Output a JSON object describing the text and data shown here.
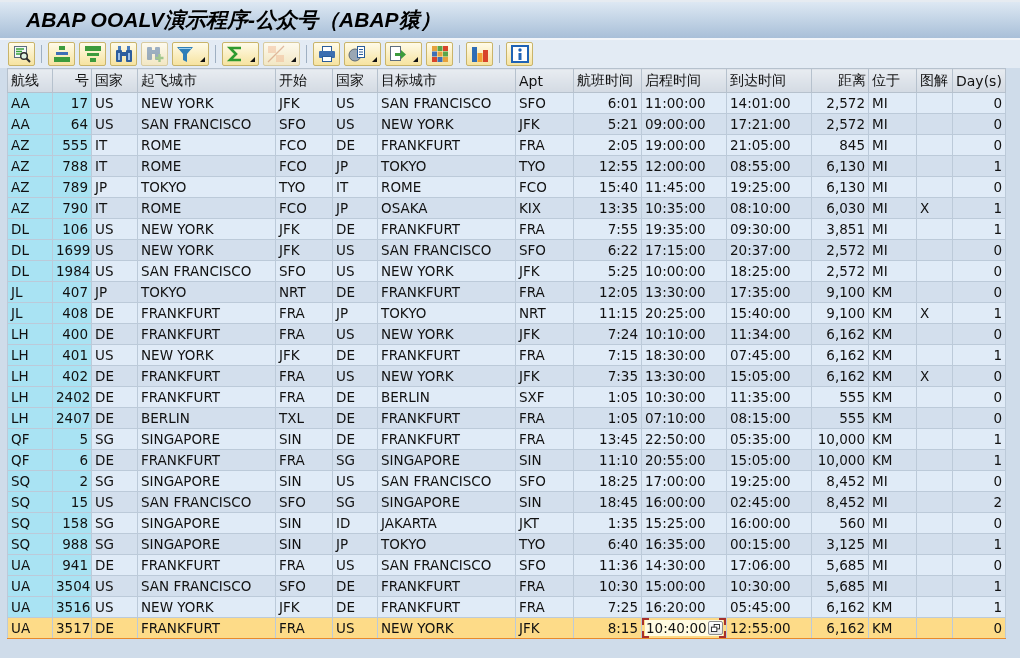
{
  "window": {
    "title": "ABAP OOALV演示程序-公众号（ABAP猿）"
  },
  "toolbar": [
    {
      "buttons": [
        {
          "kind": "details",
          "disabled": false,
          "dropdown": false
        }
      ]
    },
    {
      "buttons": [
        {
          "kind": "ascending",
          "disabled": false,
          "dropdown": false
        },
        {
          "kind": "descending",
          "disabled": false,
          "dropdown": false
        },
        {
          "kind": "find",
          "disabled": false,
          "dropdown": false
        },
        {
          "kind": "findnext",
          "disabled": true,
          "dropdown": false
        },
        {
          "kind": "filter",
          "disabled": false,
          "dropdown": true
        }
      ]
    },
    {
      "buttons": [
        {
          "kind": "sum",
          "disabled": false,
          "dropdown": true
        },
        {
          "kind": "subtotal",
          "disabled": true,
          "dropdown": true
        }
      ]
    },
    {
      "buttons": [
        {
          "kind": "print",
          "disabled": false,
          "dropdown": false
        },
        {
          "kind": "views",
          "disabled": false,
          "dropdown": true
        },
        {
          "kind": "export",
          "disabled": false,
          "dropdown": true
        },
        {
          "kind": "layout",
          "disabled": false,
          "dropdown": false
        }
      ]
    },
    {
      "buttons": [
        {
          "kind": "graphic",
          "disabled": false,
          "dropdown": false
        }
      ]
    },
    {
      "buttons": [
        {
          "kind": "info",
          "disabled": false,
          "dropdown": false
        }
      ]
    }
  ],
  "table": {
    "columns": [
      {
        "label": "航线",
        "key": true
      },
      {
        "label": "号",
        "key": true
      },
      {
        "label": "国家",
        "key": false
      },
      {
        "label": "起飞城市",
        "key": false
      },
      {
        "label": "开始",
        "key": false
      },
      {
        "label": "国家",
        "key": false
      },
      {
        "label": "目标城市",
        "key": false
      },
      {
        "label": "Apt",
        "key": false
      },
      {
        "label": "航班时间",
        "key": false
      },
      {
        "label": "启程时间",
        "key": false
      },
      {
        "label": "到达时间",
        "key": false
      },
      {
        "label": "距离",
        "key": false
      },
      {
        "label": "位于",
        "key": false
      },
      {
        "label": "图解",
        "key": false
      },
      {
        "label": "Day(s)",
        "key": false
      }
    ],
    "rows": [
      {
        "selected": false,
        "cells": [
          "AA",
          "17",
          "US",
          "NEW YORK",
          "JFK",
          "US",
          "SAN FRANCISCO",
          "SFO",
          "6:01",
          "11:00:00",
          "14:01:00",
          "2,572",
          "MI",
          null,
          "0"
        ]
      },
      {
        "selected": false,
        "cells": [
          "AA",
          "64",
          "US",
          "SAN FRANCISCO",
          "SFO",
          "US",
          "NEW YORK",
          "JFK",
          "5:21",
          "09:00:00",
          "17:21:00",
          "2,572",
          "MI",
          null,
          "0"
        ]
      },
      {
        "selected": false,
        "cells": [
          "AZ",
          "555",
          "IT",
          "ROME",
          "FCO",
          "DE",
          "FRANKFURT",
          "FRA",
          "2:05",
          "19:00:00",
          "21:05:00",
          "845",
          "MI",
          null,
          "0"
        ]
      },
      {
        "selected": false,
        "cells": [
          "AZ",
          "788",
          "IT",
          "ROME",
          "FCO",
          "JP",
          "TOKYO",
          "TYO",
          "12:55",
          "12:00:00",
          "08:55:00",
          "6,130",
          "MI",
          null,
          "1"
        ]
      },
      {
        "selected": false,
        "cells": [
          "AZ",
          "789",
          "JP",
          "TOKYO",
          "TYO",
          "IT",
          "ROME",
          "FCO",
          "15:40",
          "11:45:00",
          "19:25:00",
          "6,130",
          "MI",
          null,
          "0"
        ]
      },
      {
        "selected": false,
        "cells": [
          "AZ",
          "790",
          "IT",
          "ROME",
          "FCO",
          "JP",
          "OSAKA",
          "KIX",
          "13:35",
          "10:35:00",
          "08:10:00",
          "6,030",
          "MI",
          "X",
          "1"
        ]
      },
      {
        "selected": false,
        "cells": [
          "DL",
          "106",
          "US",
          "NEW YORK",
          "JFK",
          "DE",
          "FRANKFURT",
          "FRA",
          "7:55",
          "19:35:00",
          "09:30:00",
          "3,851",
          "MI",
          null,
          "1"
        ]
      },
      {
        "selected": false,
        "cells": [
          "DL",
          "1699",
          "US",
          "NEW YORK",
          "JFK",
          "US",
          "SAN FRANCISCO",
          "SFO",
          "6:22",
          "17:15:00",
          "20:37:00",
          "2,572",
          "MI",
          null,
          "0"
        ]
      },
      {
        "selected": false,
        "cells": [
          "DL",
          "1984",
          "US",
          "SAN FRANCISCO",
          "SFO",
          "US",
          "NEW YORK",
          "JFK",
          "5:25",
          "10:00:00",
          "18:25:00",
          "2,572",
          "MI",
          null,
          "0"
        ]
      },
      {
        "selected": false,
        "cells": [
          "JL",
          "407",
          "JP",
          "TOKYO",
          "NRT",
          "DE",
          "FRANKFURT",
          "FRA",
          "12:05",
          "13:30:00",
          "17:35:00",
          "9,100",
          "KM",
          null,
          "0"
        ]
      },
      {
        "selected": false,
        "cells": [
          "JL",
          "408",
          "DE",
          "FRANKFURT",
          "FRA",
          "JP",
          "TOKYO",
          "NRT",
          "11:15",
          "20:25:00",
          "15:40:00",
          "9,100",
          "KM",
          "X",
          "1"
        ]
      },
      {
        "selected": false,
        "cells": [
          "LH",
          "400",
          "DE",
          "FRANKFURT",
          "FRA",
          "US",
          "NEW YORK",
          "JFK",
          "7:24",
          "10:10:00",
          "11:34:00",
          "6,162",
          "KM",
          null,
          "0"
        ]
      },
      {
        "selected": false,
        "cells": [
          "LH",
          "401",
          "US",
          "NEW YORK",
          "JFK",
          "DE",
          "FRANKFURT",
          "FRA",
          "7:15",
          "18:30:00",
          "07:45:00",
          "6,162",
          "KM",
          null,
          "1"
        ]
      },
      {
        "selected": false,
        "cells": [
          "LH",
          "402",
          "DE",
          "FRANKFURT",
          "FRA",
          "US",
          "NEW YORK",
          "JFK",
          "7:35",
          "13:30:00",
          "15:05:00",
          "6,162",
          "KM",
          "X",
          "0"
        ]
      },
      {
        "selected": false,
        "cells": [
          "LH",
          "2402",
          "DE",
          "FRANKFURT",
          "FRA",
          "DE",
          "BERLIN",
          "SXF",
          "1:05",
          "10:30:00",
          "11:35:00",
          "555",
          "KM",
          null,
          "0"
        ]
      },
      {
        "selected": false,
        "cells": [
          "LH",
          "2407",
          "DE",
          "BERLIN",
          "TXL",
          "DE",
          "FRANKFURT",
          "FRA",
          "1:05",
          "07:10:00",
          "08:15:00",
          "555",
          "KM",
          null,
          "0"
        ]
      },
      {
        "selected": false,
        "cells": [
          "QF",
          "5",
          "SG",
          "SINGAPORE",
          "SIN",
          "DE",
          "FRANKFURT",
          "FRA",
          "13:45",
          "22:50:00",
          "05:35:00",
          "10,000",
          "KM",
          null,
          "1"
        ]
      },
      {
        "selected": false,
        "cells": [
          "QF",
          "6",
          "DE",
          "FRANKFURT",
          "FRA",
          "SG",
          "SINGAPORE",
          "SIN",
          "11:10",
          "20:55:00",
          "15:05:00",
          "10,000",
          "KM",
          null,
          "1"
        ]
      },
      {
        "selected": false,
        "cells": [
          "SQ",
          "2",
          "SG",
          "SINGAPORE",
          "SIN",
          "US",
          "SAN FRANCISCO",
          "SFO",
          "18:25",
          "17:00:00",
          "19:25:00",
          "8,452",
          "MI",
          null,
          "0"
        ]
      },
      {
        "selected": false,
        "cells": [
          "SQ",
          "15",
          "US",
          "SAN FRANCISCO",
          "SFO",
          "SG",
          "SINGAPORE",
          "SIN",
          "18:45",
          "16:00:00",
          "02:45:00",
          "8,452",
          "MI",
          null,
          "2"
        ]
      },
      {
        "selected": false,
        "cells": [
          "SQ",
          "158",
          "SG",
          "SINGAPORE",
          "SIN",
          "ID",
          "JAKARTA",
          "JKT",
          "1:35",
          "15:25:00",
          "16:00:00",
          "560",
          "MI",
          null,
          "0"
        ]
      },
      {
        "selected": false,
        "cells": [
          "SQ",
          "988",
          "SG",
          "SINGAPORE",
          "SIN",
          "JP",
          "TOKYO",
          "TYO",
          "6:40",
          "16:35:00",
          "00:15:00",
          "3,125",
          "MI",
          null,
          "1"
        ]
      },
      {
        "selected": false,
        "cells": [
          "UA",
          "941",
          "DE",
          "FRANKFURT",
          "FRA",
          "US",
          "SAN FRANCISCO",
          "SFO",
          "11:36",
          "14:30:00",
          "17:06:00",
          "5,685",
          "MI",
          null,
          "0"
        ]
      },
      {
        "selected": false,
        "cells": [
          "UA",
          "3504",
          "US",
          "SAN FRANCISCO",
          "SFO",
          "DE",
          "FRANKFURT",
          "FRA",
          "10:30",
          "15:00:00",
          "10:30:00",
          "5,685",
          "MI",
          null,
          "1"
        ]
      },
      {
        "selected": false,
        "cells": [
          "UA",
          "3516",
          "US",
          "NEW YORK",
          "JFK",
          "DE",
          "FRANKFURT",
          "FRA",
          "7:25",
          "16:20:00",
          "05:45:00",
          "6,162",
          "KM",
          null,
          "1"
        ]
      },
      {
        "selected": true,
        "cells": [
          "UA",
          "3517",
          "DE",
          "FRANKFURT",
          "FRA",
          "US",
          "NEW YORK",
          "JFK",
          "8:15",
          {
            "value": "10:40:00",
            "editing": true
          },
          "12:55:00",
          "6,162",
          "KM",
          null,
          "0"
        ]
      }
    ]
  }
}
